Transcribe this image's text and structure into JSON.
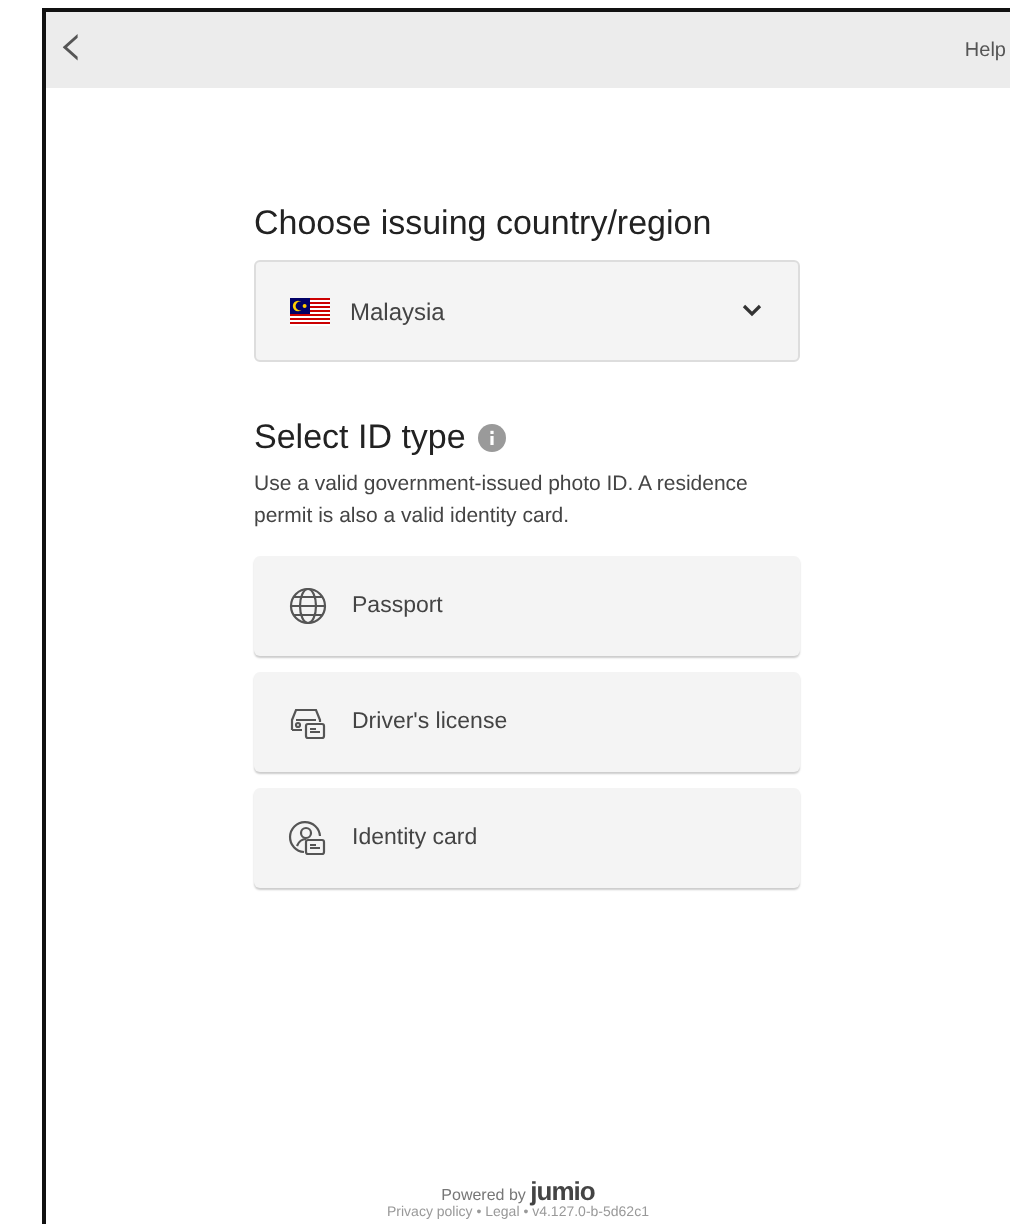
{
  "header": {
    "back": "‹",
    "help": "Help"
  },
  "country": {
    "title": "Choose issuing country/region",
    "value": "Malaysia"
  },
  "id_type": {
    "title": "Select ID type",
    "description": "Use a valid government-issued photo ID. A residence permit is also a valid identity card.",
    "options": [
      {
        "kind": "passport",
        "label": "Passport"
      },
      {
        "kind": "license",
        "label": "Driver's license"
      },
      {
        "kind": "idcard",
        "label": "Identity card"
      }
    ]
  },
  "footer": {
    "powered": "Powered by",
    "brand": "jumio",
    "links": "Privacy policy • Legal • v4.127.0-b-5d62c1"
  }
}
